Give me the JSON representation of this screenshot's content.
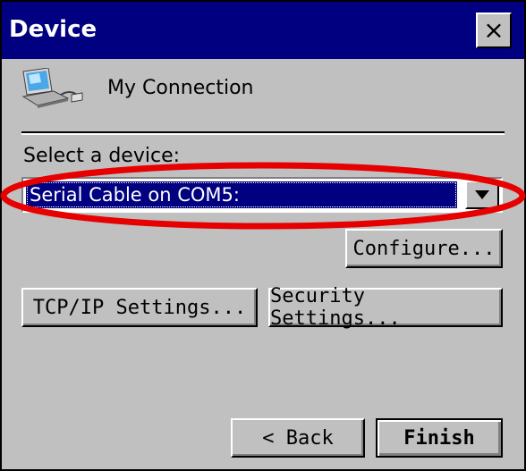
{
  "window": {
    "title": "Device",
    "close_label": "×"
  },
  "connection": {
    "name": "My Connection",
    "icon": "connection-computer-icon"
  },
  "device_select": {
    "label": "Select a device:",
    "selected_value": "Serial Cable on COM5:"
  },
  "buttons": {
    "configure": "Configure...",
    "tcp_ip": "TCP/IP Settings...",
    "security": "Security Settings...",
    "back": "< Back",
    "finish": "Finish"
  },
  "colors": {
    "titlebar": "#000080",
    "window_face": "#c0c0c0",
    "selection": "#000080",
    "annotation": "#e60000"
  }
}
